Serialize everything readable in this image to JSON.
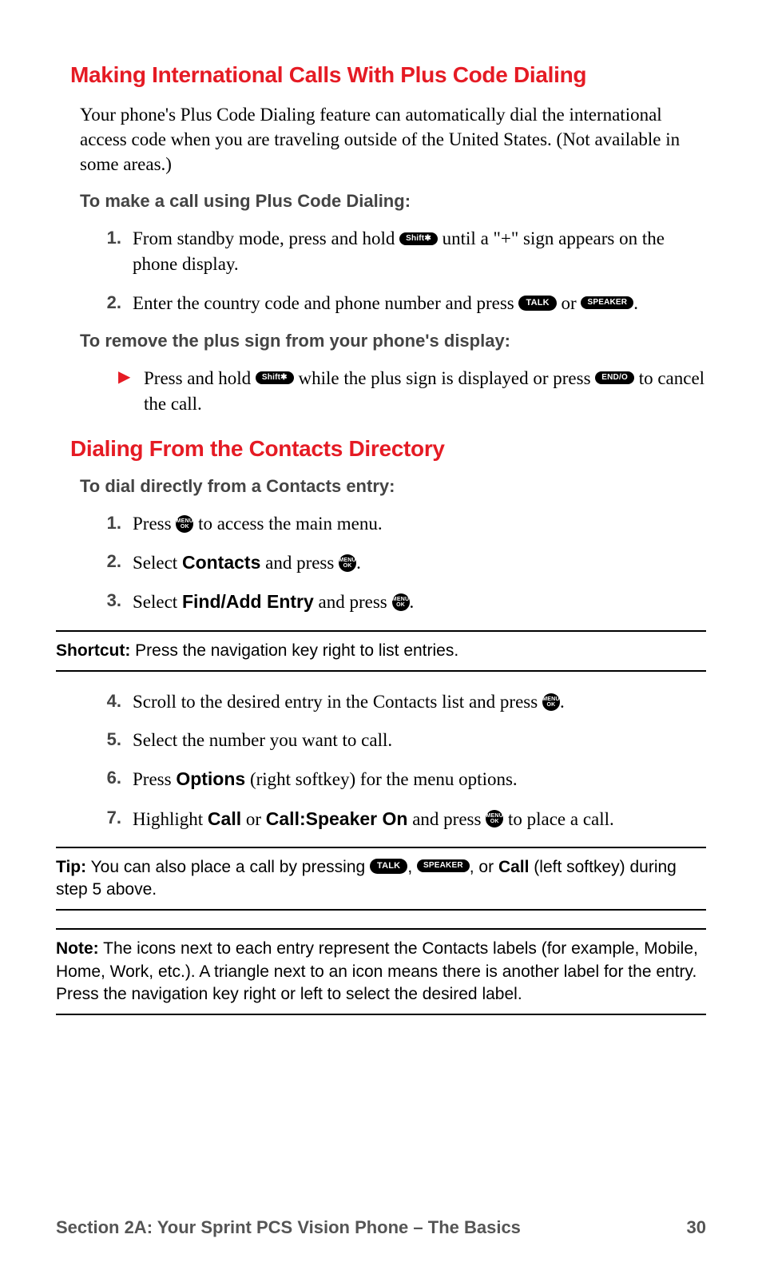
{
  "h1": "Making International Calls With Plus Code Dialing",
  "p1": "Your phone's Plus Code Dialing feature can automatically dial the international access code when you are traveling outside of the United States. (Not available in some areas.)",
  "sub1": "To make a call using Plus Code Dialing:",
  "s1_1a": "From standby mode, press and hold ",
  "s1_1b": " until a \"+\" sign appears on the phone display.",
  "s1_2a": "Enter the country code and phone number and press ",
  "s1_2b": " or ",
  "sub2": "To remove the plus sign from your phone's display:",
  "b1a": "Press and hold ",
  "b1b": " while the plus sign is displayed or press ",
  "b1c": " to cancel the call.",
  "h2": "Dialing From the Contacts Directory",
  "sub3": "To dial directly from a Contacts entry:",
  "s2_1a": "Press ",
  "s2_1b": " to access the main menu.",
  "s2_2a": "Select ",
  "s2_2b": "Contacts",
  "s2_2c": " and press ",
  "s2_3a": "Select ",
  "s2_3b": "Find/Add Entry",
  "s2_3c": " and press ",
  "shortcut_label": "Shortcut:",
  "shortcut_text": " Press the navigation key right to list entries.",
  "s2_4a": "Scroll to the desired entry in the Contacts list and press ",
  "s2_5": "Select the number you want to call.",
  "s2_6a": "Press ",
  "s2_6b": "Options",
  "s2_6c": " (right softkey) for the menu options.",
  "s2_7a": "Highlight ",
  "s2_7b": "Call",
  "s2_7c": " or ",
  "s2_7d": "Call:Speaker On",
  "s2_7e": " and press ",
  "s2_7f": " to place a call.",
  "tip_label": "Tip:",
  "tip_a": " You can also place a call by pressing ",
  "tip_b": ", ",
  "tip_c": ", or ",
  "tip_d": "Call",
  "tip_e": " (left softkey) during step 5 above.",
  "note_label": "Note:",
  "note_text": " The icons next to each entry represent the Contacts labels (for example, Mobile, Home, Work, etc.). A triangle next to an icon means there is another label for the entry. Press the navigation key right or left to select the desired label.",
  "key_shift": "Shift✱",
  "key_talk": "TALK",
  "key_speaker": "SPEAKER",
  "key_end": "END/O",
  "key_menu_top": "MENU",
  "key_menu_bot": "OK",
  "footer_left": "Section 2A: Your Sprint PCS Vision Phone – The Basics",
  "footer_right": "30",
  "n1": "1.",
  "n2": "2.",
  "n3": "3.",
  "n4": "4.",
  "n5": "5.",
  "n6": "6.",
  "n7": "7.",
  "dot": "."
}
